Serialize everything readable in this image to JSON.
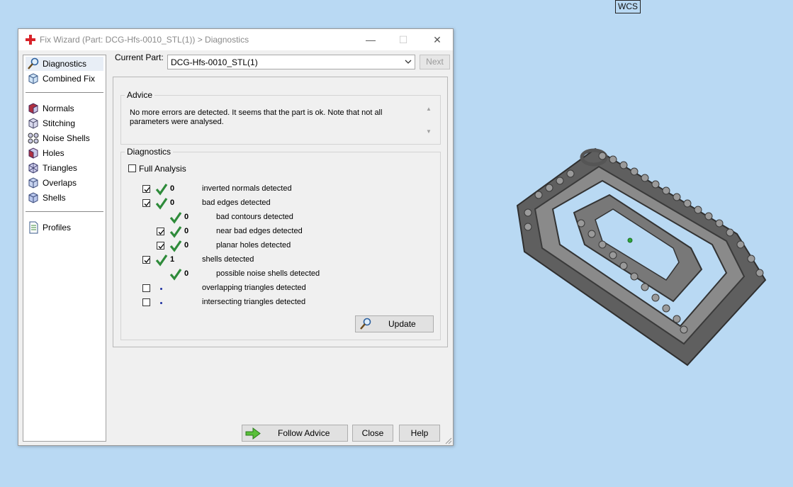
{
  "viewport": {
    "wcs_label": "WCS"
  },
  "window": {
    "title": "Fix Wizard (Part: DCG-Hfs-0010_STL(1)) > Diagnostics",
    "minimize": "—",
    "maximize": "☐",
    "close": "✕"
  },
  "sidebar": {
    "items": [
      {
        "label": "Diagnostics",
        "icon": "magnifier-icon"
      },
      {
        "label": "Combined Fix",
        "icon": "cube-icon"
      },
      {
        "label": "Normals",
        "icon": "normals-cube-icon"
      },
      {
        "label": "Stitching",
        "icon": "stitching-cube-icon"
      },
      {
        "label": "Noise Shells",
        "icon": "noise-shells-icon"
      },
      {
        "label": "Holes",
        "icon": "holes-cube-icon"
      },
      {
        "label": "Triangles",
        "icon": "triangles-cube-icon"
      },
      {
        "label": "Overlaps",
        "icon": "overlaps-cube-icon"
      },
      {
        "label": "Shells",
        "icon": "shells-cube-icon"
      },
      {
        "label": "Profiles",
        "icon": "document-icon"
      }
    ]
  },
  "current_part": {
    "label": "Current Part:",
    "value": "DCG-Hfs-0010_STL(1)",
    "next_label": "Next"
  },
  "advice": {
    "title": "Advice",
    "text": "No more errors are detected. It seems that the part is ok. Note that not all parameters were analysed."
  },
  "diagnostics": {
    "title": "Diagnostics",
    "full_analysis_label": "Full Analysis",
    "rows": [
      {
        "label": "inverted normals detected",
        "count": "0"
      },
      {
        "label": "bad edges detected",
        "count": "0"
      },
      {
        "label": "bad contours detected",
        "count": "0"
      },
      {
        "label": "near bad edges detected",
        "count": "0"
      },
      {
        "label": "planar holes detected",
        "count": "0"
      },
      {
        "label": "shells detected",
        "count": "1"
      },
      {
        "label": "possible noise shells detected",
        "count": "0"
      },
      {
        "label": "overlapping triangles detected",
        "count": ""
      },
      {
        "label": "intersecting triangles detected",
        "count": ""
      }
    ],
    "update_label": "Update"
  },
  "footer": {
    "follow_advice": "Follow Advice",
    "close": "Close",
    "help": "Help"
  },
  "colors": {
    "viewport_bg": "#b9d9f3",
    "check_green": "#2e8b3a",
    "model_gray": "#6e6e6e",
    "app_icon_red": "#d8232a"
  }
}
